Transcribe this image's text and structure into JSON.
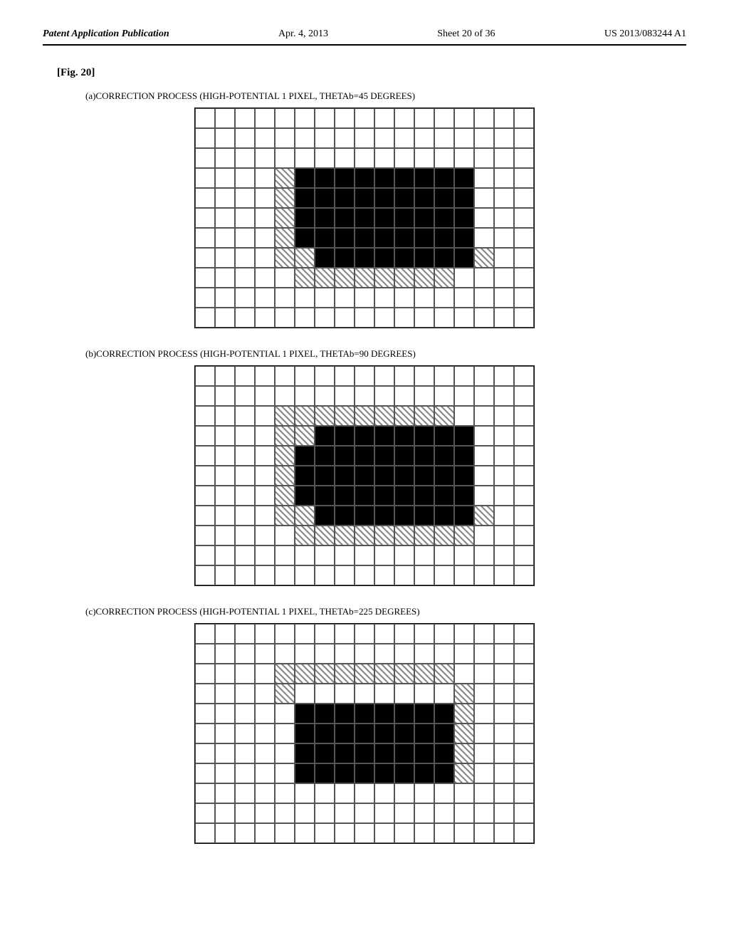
{
  "header": {
    "left": "Patent Application Publication",
    "center": "Apr. 4, 2013",
    "sheet": "Sheet 20 of 36",
    "right": "US 2013/083244 A1"
  },
  "fig_label": "[Fig. 20]",
  "sections": [
    {
      "id": "a",
      "title": "(a)CORRECTION PROCESS (HIGH-POTENTIAL 1 PIXEL, THETAb=45 DEGREES)",
      "rows": 11,
      "cols": 17,
      "cells": [
        "e",
        "e",
        "e",
        "e",
        "e",
        "e",
        "e",
        "e",
        "e",
        "e",
        "e",
        "e",
        "e",
        "e",
        "e",
        "e",
        "e",
        "e",
        "e",
        "e",
        "e",
        "e",
        "e",
        "e",
        "e",
        "e",
        "e",
        "e",
        "e",
        "e",
        "e",
        "e",
        "e",
        "e",
        "e",
        "e",
        "e",
        "e",
        "e",
        "e",
        "e",
        "e",
        "e",
        "e",
        "e",
        "e",
        "e",
        "e",
        "e",
        "e",
        "e",
        "e",
        "e",
        "e",
        "e",
        "h",
        "b",
        "b",
        "b",
        "b",
        "b",
        "b",
        "b",
        "b",
        "b",
        "e",
        "e",
        "e",
        "e",
        "e",
        "e",
        "e",
        "h",
        "b",
        "b",
        "b",
        "b",
        "b",
        "b",
        "b",
        "b",
        "b",
        "e",
        "e",
        "e",
        "e",
        "e",
        "e",
        "e",
        "h",
        "b",
        "b",
        "b",
        "b",
        "b",
        "b",
        "b",
        "b",
        "b",
        "e",
        "e",
        "e",
        "e",
        "e",
        "e",
        "e",
        "h",
        "b",
        "b",
        "b",
        "b",
        "b",
        "b",
        "b",
        "b",
        "b",
        "e",
        "e",
        "e",
        "e",
        "e",
        "e",
        "e",
        "h",
        "h",
        "b",
        "b",
        "b",
        "b",
        "b",
        "b",
        "b",
        "b",
        "h",
        "e",
        "e",
        "e",
        "e",
        "e",
        "e",
        "e",
        "h",
        "h",
        "h",
        "h",
        "h",
        "h",
        "h",
        "h",
        "e",
        "e",
        "e",
        "e",
        "e",
        "e",
        "e",
        "e",
        "e",
        "e",
        "e",
        "e",
        "e",
        "e",
        "e",
        "e",
        "e",
        "e",
        "e",
        "e",
        "e",
        "e",
        "e",
        "e",
        "e",
        "e",
        "e",
        "e",
        "e",
        "e",
        "e",
        "e",
        "e",
        "e",
        "e",
        "e",
        "e",
        "e"
      ]
    },
    {
      "id": "b",
      "title": "(b)CORRECTION PROCESS (HIGH-POTENTIAL 1 PIXEL, THETAb=90 DEGREES)",
      "rows": 11,
      "cols": 17,
      "cells": [
        "e",
        "e",
        "e",
        "e",
        "e",
        "e",
        "e",
        "e",
        "e",
        "e",
        "e",
        "e",
        "e",
        "e",
        "e",
        "e",
        "e",
        "e",
        "e",
        "e",
        "e",
        "e",
        "e",
        "e",
        "e",
        "e",
        "e",
        "e",
        "e",
        "e",
        "e",
        "e",
        "e",
        "e",
        "e",
        "e",
        "e",
        "e",
        "h",
        "h",
        "h",
        "h",
        "h",
        "h",
        "h",
        "h",
        "h",
        "e",
        "e",
        "e",
        "e",
        "e",
        "e",
        "e",
        "e",
        "h",
        "h",
        "b",
        "b",
        "b",
        "b",
        "b",
        "b",
        "b",
        "b",
        "e",
        "e",
        "e",
        "e",
        "e",
        "e",
        "e",
        "h",
        "b",
        "b",
        "b",
        "b",
        "b",
        "b",
        "b",
        "b",
        "b",
        "e",
        "e",
        "e",
        "e",
        "e",
        "e",
        "e",
        "h",
        "b",
        "b",
        "b",
        "b",
        "b",
        "b",
        "b",
        "b",
        "b",
        "e",
        "e",
        "e",
        "e",
        "e",
        "e",
        "e",
        "h",
        "b",
        "b",
        "b",
        "b",
        "b",
        "b",
        "b",
        "b",
        "b",
        "e",
        "e",
        "e",
        "e",
        "e",
        "e",
        "e",
        "h",
        "h",
        "b",
        "b",
        "b",
        "b",
        "b",
        "b",
        "b",
        "b",
        "h",
        "e",
        "e",
        "e",
        "e",
        "e",
        "e",
        "e",
        "h",
        "h",
        "h",
        "h",
        "h",
        "h",
        "h",
        "h",
        "h",
        "e",
        "e",
        "e",
        "e",
        "e",
        "e",
        "e",
        "e",
        "e",
        "e",
        "e",
        "e",
        "e",
        "e",
        "e",
        "e",
        "e",
        "e",
        "e",
        "e",
        "e",
        "e",
        "e",
        "e",
        "e",
        "e",
        "e",
        "e",
        "e",
        "e",
        "e",
        "e",
        "e",
        "e",
        "e",
        "e",
        "e"
      ]
    },
    {
      "id": "c",
      "title": "(c)CORRECTION PROCESS (HIGH-POTENTIAL 1 PIXEL, THETAb=225 DEGREES)",
      "rows": 11,
      "cols": 17,
      "cells": [
        "e",
        "e",
        "e",
        "e",
        "e",
        "e",
        "e",
        "e",
        "e",
        "e",
        "e",
        "e",
        "e",
        "e",
        "e",
        "e",
        "e",
        "e",
        "e",
        "e",
        "e",
        "e",
        "e",
        "e",
        "e",
        "e",
        "e",
        "e",
        "e",
        "e",
        "e",
        "e",
        "e",
        "e",
        "e",
        "e",
        "e",
        "e",
        "h",
        "h",
        "h",
        "h",
        "h",
        "h",
        "h",
        "h",
        "h",
        "e",
        "e",
        "e",
        "e",
        "e",
        "e",
        "e",
        "e",
        "h",
        "e",
        "e",
        "e",
        "e",
        "e",
        "e",
        "e",
        "e",
        "h",
        "e",
        "e",
        "e",
        "e",
        "e",
        "e",
        "e",
        "e",
        "b",
        "b",
        "b",
        "b",
        "b",
        "b",
        "b",
        "b",
        "h",
        "e",
        "e",
        "e",
        "e",
        "e",
        "e",
        "e",
        "e",
        "b",
        "b",
        "b",
        "b",
        "b",
        "b",
        "b",
        "b",
        "h",
        "e",
        "e",
        "e",
        "e",
        "e",
        "e",
        "e",
        "e",
        "b",
        "b",
        "b",
        "b",
        "b",
        "b",
        "b",
        "b",
        "h",
        "e",
        "e",
        "e",
        "e",
        "e",
        "e",
        "e",
        "e",
        "b",
        "b",
        "b",
        "b",
        "b",
        "b",
        "b",
        "b",
        "h",
        "e",
        "e",
        "e",
        "e",
        "e",
        "e",
        "e",
        "e",
        "e",
        "e",
        "e",
        "e",
        "e",
        "e",
        "e",
        "e",
        "e",
        "e",
        "e",
        "e",
        "e",
        "e",
        "e",
        "e",
        "e",
        "e",
        "e",
        "e",
        "e",
        "e",
        "e",
        "e",
        "e",
        "e",
        "e",
        "e",
        "e",
        "e",
        "e",
        "e",
        "e",
        "e",
        "e",
        "e",
        "e",
        "e",
        "e",
        "e",
        "e",
        "e",
        "e",
        "e",
        "e",
        "e"
      ]
    }
  ]
}
